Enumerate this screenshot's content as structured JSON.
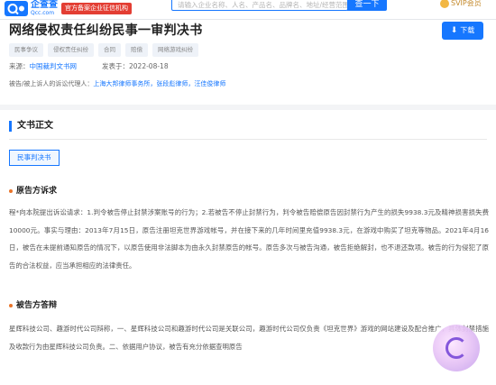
{
  "topbar": {
    "logo_text": "企查查",
    "logo_sub": "Qcc.com",
    "official_badge": "官方备案企业征信机构",
    "search_placeholder": "请输入企业名称、人名、产品名、品牌名、地址/经营范围等",
    "search_button": "查一下",
    "svip_label": "SVIP会员"
  },
  "header": {
    "title": "网络侵权责任纠纷民事一审判决书",
    "download_label": "下载",
    "tags": [
      "民事争议",
      "侵权责任纠纷",
      "合同",
      "赔偿",
      "网络游戏纠纷"
    ],
    "source_label": "来源：",
    "source_value": "中国裁判文书网",
    "publish_label": "发表于：",
    "publish_date": "2022-08-18",
    "parties_label": "被告/被上诉人的诉讼代理人：",
    "parties_values": "上海大邦律师事务所，张段彪律师，汪佳俊律师"
  },
  "body": {
    "section_title": "文书正文",
    "subtab": "民事判决书",
    "plaintiff_heading": "原告方诉求",
    "plaintiff_text": "程*向本院提出诉讼请求：1.判令被告停止封禁涉案账号的行为；2.若被告不停止封禁行为，判令被告赔偿原告因封禁行为产生的损失9938.3元及精神损害损失费10000元。事实与理由：2013年7月15日，原告注册坦克世界游戏帐号，并在接下来的几年时间里充值9938.3元，在游戏中购买了坦克等物品。2021年4月16日，被告在未提前通知原告的情况下，以原告使用非法脚本为由永久封禁原告的帐号。原告多次与被告沟通，被告拒绝解封，也不退还款项。被告的行为侵犯了原告的合法权益，应当承担相应的法律责任。",
    "defendant_heading": "被告方答辩",
    "defendant_text": "星辉科技公司、趣游时代公司辩称，一、星辉科技公司和趣游时代公司是关联公司，趣游时代公司仅负责《坦克世界》游戏的网站建设及配合推广，具体封禁措施及收款行为由星辉科技公司负责。二、依据用户协议，被告有充分依据查明原告"
  }
}
